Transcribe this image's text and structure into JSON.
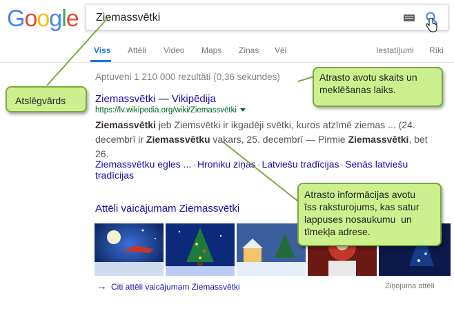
{
  "logo": {
    "letters": [
      "G",
      "o",
      "o",
      "g",
      "l",
      "e"
    ],
    "colors": [
      "#4285f4",
      "#ea4335",
      "#fbbc05",
      "#4285f4",
      "#34a853",
      "#ea4335"
    ]
  },
  "search": {
    "query": "Ziemassvētki"
  },
  "tabs": [
    {
      "label": "Viss",
      "active": true
    },
    {
      "label": "Attēli"
    },
    {
      "label": "Video"
    },
    {
      "label": "Maps"
    },
    {
      "label": "Ziņas"
    },
    {
      "label": "Vēl"
    },
    {
      "label": "Iestatījumi"
    },
    {
      "label": "Rīki"
    }
  ],
  "stats": "Aptuveni 1 210 000 rezultāti (0,36 sekundes)",
  "result": {
    "title": "Ziemassvētki — Vikipēdija",
    "url": "https://lv.wikipedia.org/wiki/Ziemassvētki",
    "snippet": {
      "b1": "Ziemassvētki",
      "t1": " jeb Ziemsvētki ir ikgadēji svētki, kuros atzīmē ziemas ... (24. decembrī ir ",
      "b2": "Ziemassvētku",
      "t2": " vakars, 25. decembrī — Pirmie ",
      "b3": "Ziemassvētki",
      "t3": ", bet 26."
    },
    "sitelinks": [
      "Ziemassvētku egles ...",
      "Hroniku ziņas",
      "Latviešu tradīcijas",
      "Senās latviešu tradīcijas"
    ]
  },
  "images": {
    "heading": "Attēli vaicājumam Ziemassvētki",
    "more": "Citi attēli vaicājumam Ziemassvētki",
    "report": "Ziņojuma attēli"
  },
  "callouts": {
    "keyword": "Atslēgvārds",
    "stats_note": [
      "Atrasto avotu skaits un",
      "meklēšanas laiks."
    ],
    "summary_note": [
      "Atrasto informācijas avotu",
      "īss raksturojums, kas satur",
      "lappuses nosaukumu  un",
      "tīmekļa adrese."
    ]
  },
  "colors": {
    "link": "#1a0dab",
    "url": "#006621",
    "accent": "#1a73e8",
    "callout_fill": "#ccf08e",
    "callout_border": "#7ca83a"
  }
}
